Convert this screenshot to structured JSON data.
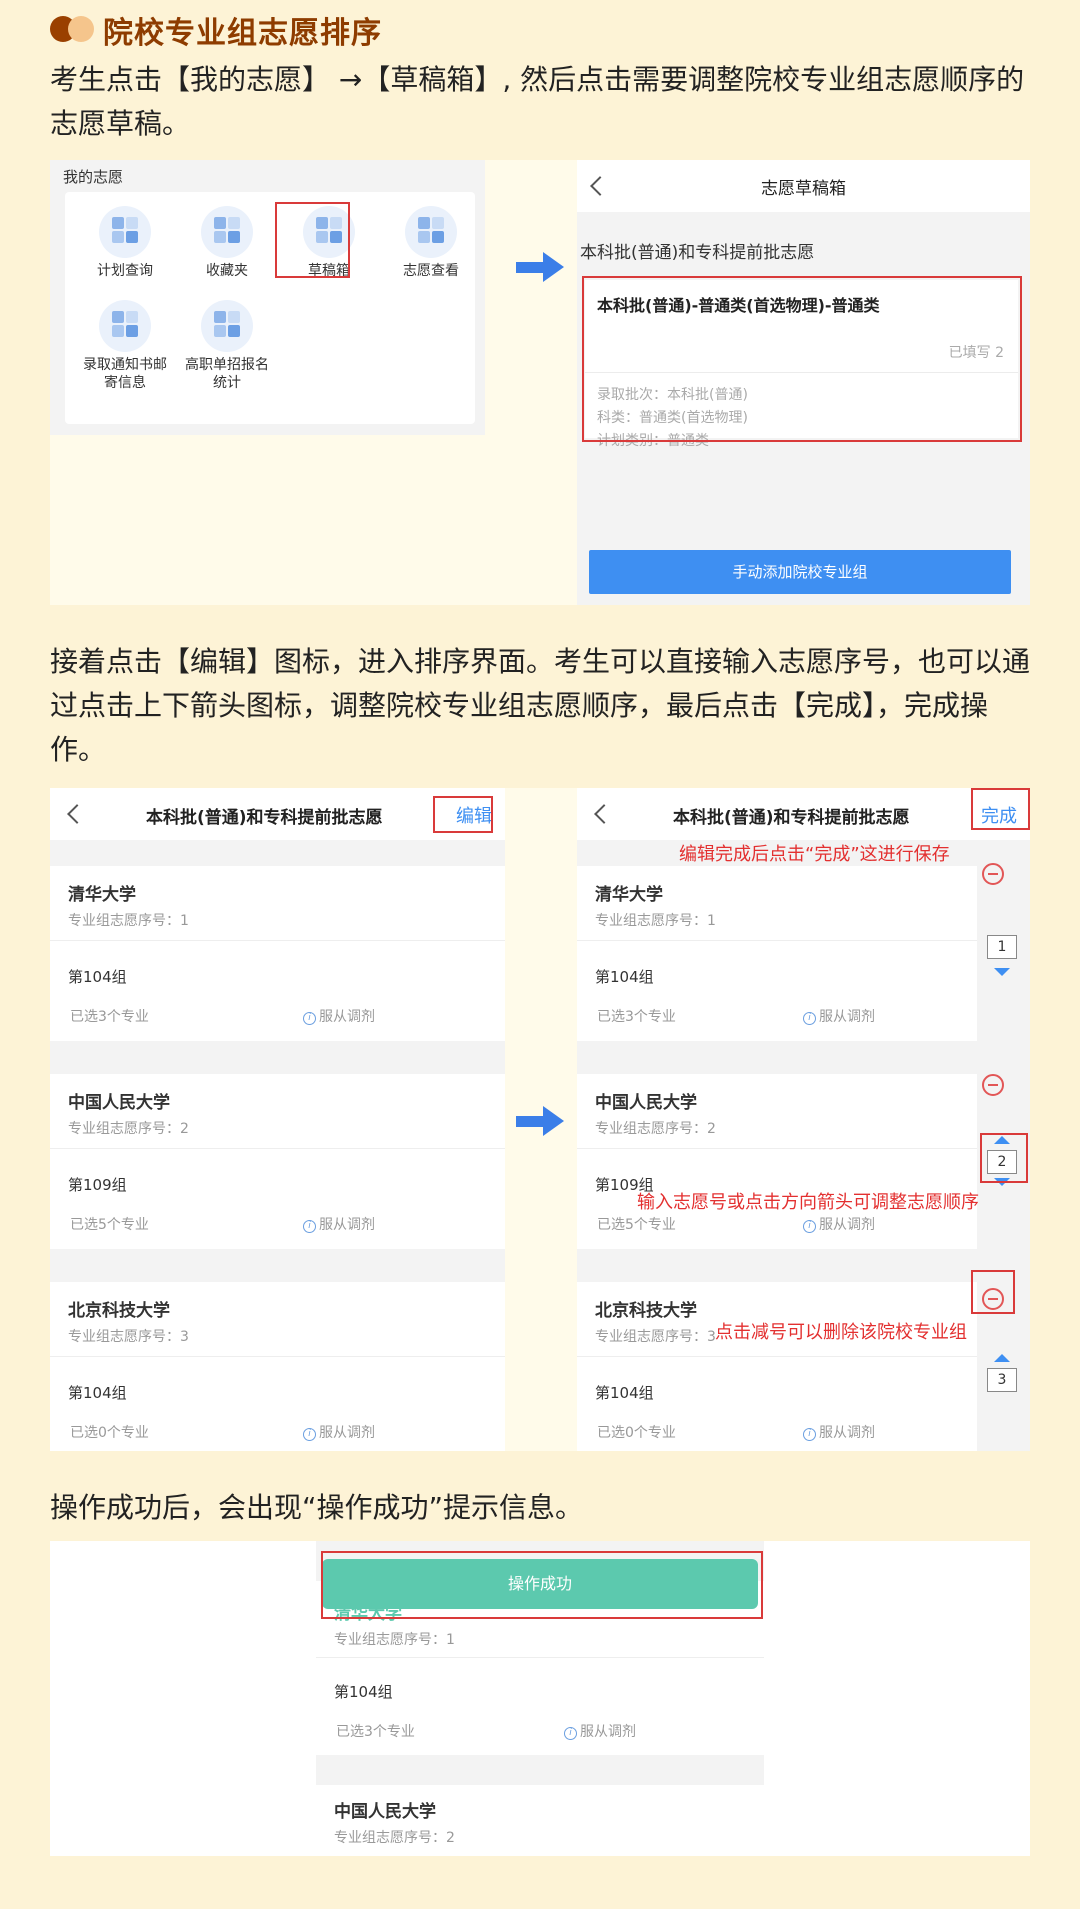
{
  "header": {
    "title": "院校专业组志愿排序"
  },
  "paragraphs": {
    "p1": "考生点击【我的志愿】 →【草稿箱】, 然后点击需要调整院校专业组志愿顺序的志愿草稿。",
    "p2": "接着点击【编辑】图标，进入排序界面。考生可以直接输入志愿序号，也可以通过点击上下箭头图标，调整院校专业组志愿顺序，最后点击【完成】，完成操作。",
    "p3": "操作成功后，会出现“操作成功”提示信息。"
  },
  "screen1": {
    "my_title": "我的志愿",
    "apps": [
      {
        "label": "计划查询",
        "icon": "plan-query-icon"
      },
      {
        "label": "收藏夹",
        "icon": "favorites-icon"
      },
      {
        "label": "草稿箱",
        "icon": "drafts-icon"
      },
      {
        "label": "志愿查看",
        "icon": "view-choices-icon"
      },
      {
        "label": "录取通知书邮寄信息",
        "icon": "mail-info-icon"
      },
      {
        "label": "高职单招报名统计",
        "icon": "vocational-stats-icon"
      }
    ],
    "draft": {
      "nav_title": "志愿草稿箱",
      "section": "本科批(普通)和专科提前批志愿",
      "card_title": "本科批(普通)-普通类(首选物理)-普通类",
      "filled": "已填写 2",
      "meta": [
        "录取批次：本科批(普通)",
        "科类：普通类(首选物理)",
        "计划类别：普通类"
      ],
      "button": "手动添加院校专业组"
    }
  },
  "screen2": {
    "nav_title": "本科批(普通)和专科提前批志愿",
    "edit_label": "编辑",
    "done_label": "完成",
    "universities": [
      {
        "name": "清华大学",
        "seq": "专业组志愿序号：1",
        "group": "第104组",
        "selected": "已选3个专业",
        "adjust": "服从调剂",
        "order": "1"
      },
      {
        "name": "中国人民大学",
        "seq": "专业组志愿序号：2",
        "group": "第109组",
        "selected": "已选5个专业",
        "adjust": "服从调剂",
        "order": "2"
      },
      {
        "name": "北京科技大学",
        "seq": "专业组志愿序号：3",
        "group": "第104组",
        "selected": "已选0个专业",
        "adjust": "服从调剂",
        "order": "3"
      }
    ],
    "notes": {
      "save": "编辑完成后点击“完成”这进行保存",
      "order": "输入志愿号或点击方向箭头可调整志愿顺序",
      "delete": "点击减号可以删除该院校专业组"
    }
  },
  "screen3": {
    "toast": "操作成功",
    "universities": [
      {
        "name": "清华大学",
        "seq": "专业组志愿序号：1",
        "group": "第104组",
        "selected": "已选3个专业",
        "adjust": "服从调剂"
      },
      {
        "name": "中国人民大学",
        "seq": "专业组志愿序号：2"
      }
    ]
  },
  "colors": {
    "background": "#fdf3d6",
    "title": "#8e3c00",
    "accent_blue": "#3e8ff2",
    "highlight_red": "#d93a3a",
    "toast_green": "#5cc9ae"
  }
}
